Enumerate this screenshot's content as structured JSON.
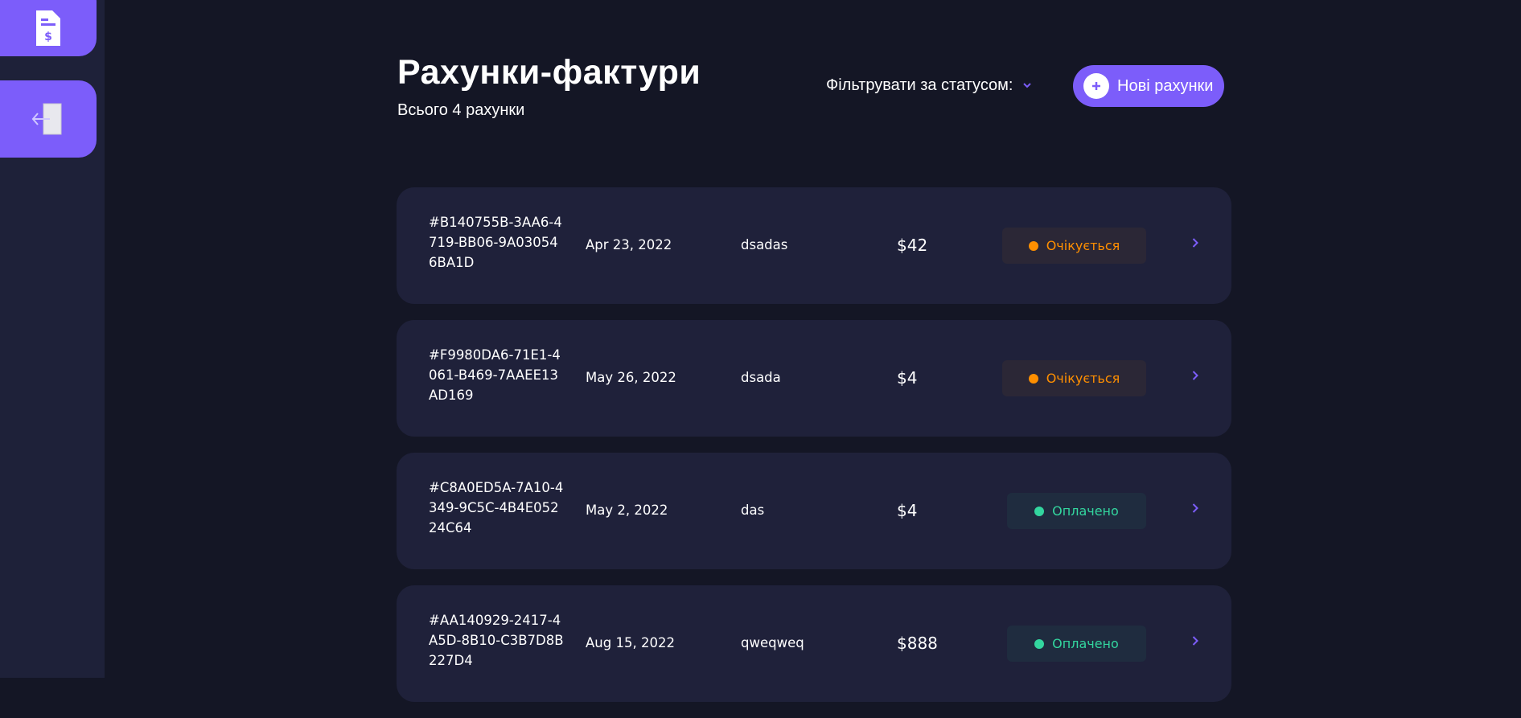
{
  "sidebar": {
    "invoices_icon": "invoice-dollar-icon",
    "logout_icon": "logout-door-icon"
  },
  "header": {
    "title": "Рахунки-фактури",
    "subtitle": "Всього 4 рахунки",
    "filter_label": "Фільтрувати за статусом:",
    "new_button_label": "Нові рахунки"
  },
  "colors": {
    "accent": "#7c5dfa",
    "background": "#141625",
    "card": "#1f213a",
    "pending": "#ff8f00",
    "paid": "#33d69f"
  },
  "invoices": [
    {
      "id": "#B140755B-3AA6-4719-BB06-9A030546BA1D",
      "date": "Apr 23, 2022",
      "client": "dsadas",
      "amount": "$42",
      "status": "Очікується"
    },
    {
      "id": "#F9980DA6-71E1-4061-B469-7AAEE13AD169",
      "date": "May 26, 2022",
      "client": "dsada",
      "amount": "$4",
      "status": "Очікується"
    },
    {
      "id": "#C8A0ED5A-7A10-4349-9C5C-4B4E05224C64",
      "date": "May 2, 2022",
      "client": "das",
      "amount": "$4",
      "status": "Оплачено"
    },
    {
      "id": "#AA140929-2417-4A5D-8B10-C3B7D8B227D4",
      "date": "Aug 15, 2022",
      "client": "qweqweq",
      "amount": "$888",
      "status": "Оплачено"
    }
  ]
}
